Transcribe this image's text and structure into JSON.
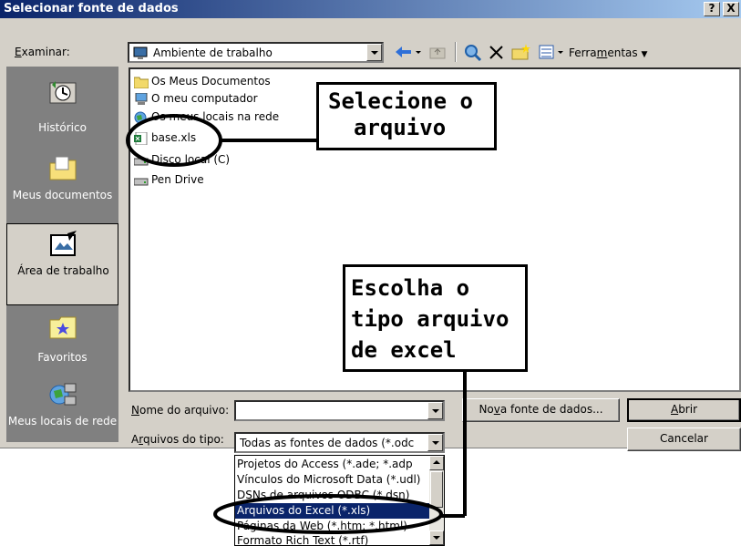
{
  "window": {
    "title": "Selecionar fonte de dados",
    "help_glyph": "?",
    "close_glyph": "X"
  },
  "toolbar": {
    "look_in_label_u": "E",
    "look_in_label_rest": "xaminar:",
    "look_in_value": "Ambiente de trabalho",
    "tools_label_a": "Ferra",
    "tools_label_u": "m",
    "tools_label_b": "entas"
  },
  "places": [
    {
      "label": "Histórico",
      "icon": "history-icon"
    },
    {
      "label": "Meus documentos",
      "icon": "my-documents-icon"
    },
    {
      "label": "Área de trabalho",
      "icon": "desktop-icon",
      "selected": true
    },
    {
      "label": "Favoritos",
      "icon": "favorites-icon"
    },
    {
      "label": "Meus locais de rede",
      "icon": "network-places-icon"
    }
  ],
  "files": [
    {
      "name": "Os Meus Documentos",
      "icon": "folder-icon"
    },
    {
      "name": "O meu computador",
      "icon": "computer-icon"
    },
    {
      "name": "Os meus locais na rede",
      "icon": "network-icon"
    },
    {
      "name": "base.xls",
      "icon": "excel-file-icon"
    },
    {
      "name": "Disco local (C)",
      "icon": "drive-icon"
    },
    {
      "name": "Pen Drive",
      "icon": "drive-icon"
    }
  ],
  "filename": {
    "label_u": "N",
    "label_rest": "ome do arquivo:",
    "value": ""
  },
  "filetype": {
    "label_a": "A",
    "label_u": "r",
    "label_b": "quivos do tipo:",
    "value": "Todas as fontes de dados (*.odc"
  },
  "buttons": {
    "new_source_a": "No",
    "new_source_u": "v",
    "new_source_b": "a fonte de dados...",
    "open_u": "A",
    "open_rest": "brir",
    "cancel": "Cancelar"
  },
  "type_options": [
    {
      "label": "Projetos do Access (*.ade; *.adp"
    },
    {
      "label": "Vínculos do Microsoft Data (*.udl)"
    },
    {
      "label": "DSNs de arquivos ODBC (*.dsn)"
    },
    {
      "label": "Arquivos do Excel (*.xls)",
      "highlighted": true
    },
    {
      "label": "Páginas da Web (*.htm; *.html)"
    },
    {
      "label": "Formato Rich Text (*.rtf)"
    }
  ],
  "annotations": {
    "select_file": [
      "Selecione o",
      "arquivo"
    ],
    "choose_type": [
      "Escolha o",
      "tipo arquivo",
      "de excel"
    ]
  },
  "colors": {
    "title_bar": "#0a246a",
    "highlight": "#0a246a",
    "dialog_face": "#d4d0c8",
    "places_bar": "#808080"
  }
}
